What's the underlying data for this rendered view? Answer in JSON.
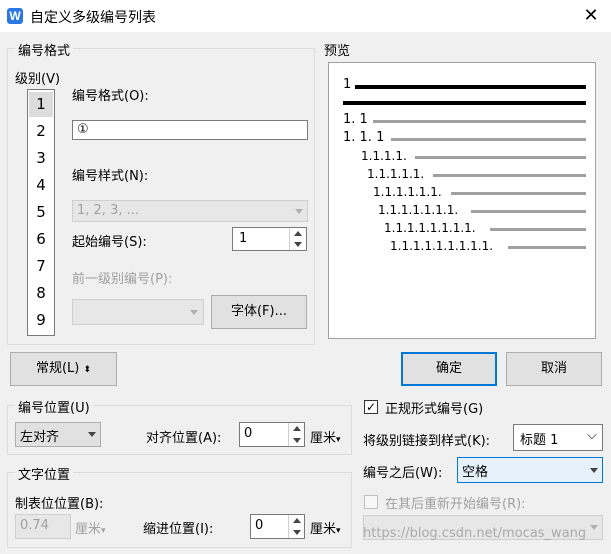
{
  "window": {
    "title": "自定义多级编号列表",
    "app_icon": "W"
  },
  "format_group": {
    "title": "编号格式",
    "level_label": "级别(V)",
    "levels": [
      "1",
      "2",
      "3",
      "4",
      "5",
      "6",
      "7",
      "8",
      "9"
    ],
    "selected_level": "1",
    "number_format_label": "编号格式(O):",
    "number_format_value": "①",
    "number_style_label": "编号样式(N):",
    "number_style_value": "1, 2, 3, ...",
    "start_at_label": "起始编号(S):",
    "start_at_value": "1",
    "prev_level_label": "前一级别编号(P):",
    "font_button": "字体(F)..."
  },
  "preview": {
    "title": "预览",
    "lines": [
      "1",
      "1. 1",
      "1. 1. 1",
      "1.1.1.1.",
      "1.1.1.1.1.",
      "1.1.1.1.1.1.",
      "1.1.1.1.1.1.1.",
      "1.1.1.1.1.1.1.1.",
      "1.1.1.1.1.1.1.1.1."
    ]
  },
  "buttons": {
    "general": "常规(L)",
    "ok": "确定",
    "cancel": "取消"
  },
  "number_position": {
    "title": "编号位置(U)",
    "alignment_value": "左对齐",
    "align_at_label": "对齐位置(A):",
    "align_at_value": "0",
    "unit": "厘米"
  },
  "text_position": {
    "title": "文字位置",
    "tab_label": "制表位位置(B):",
    "tab_value": "0.74",
    "tab_unit": "厘米",
    "indent_label": "缩进位置(I):",
    "indent_value": "0",
    "indent_unit": "厘米"
  },
  "options": {
    "legal_numbering": "正规形式编号(G)",
    "legal_checked": true,
    "link_style_label": "将级别链接到样式(K):",
    "link_style_value": "标题 1",
    "follow_label": "编号之后(W):",
    "follow_value": "空格",
    "restart_label": "在其后重新开始编号(R):",
    "restart_checked": false
  },
  "watermark": "https://blog.csdn.net/mocas_wang"
}
